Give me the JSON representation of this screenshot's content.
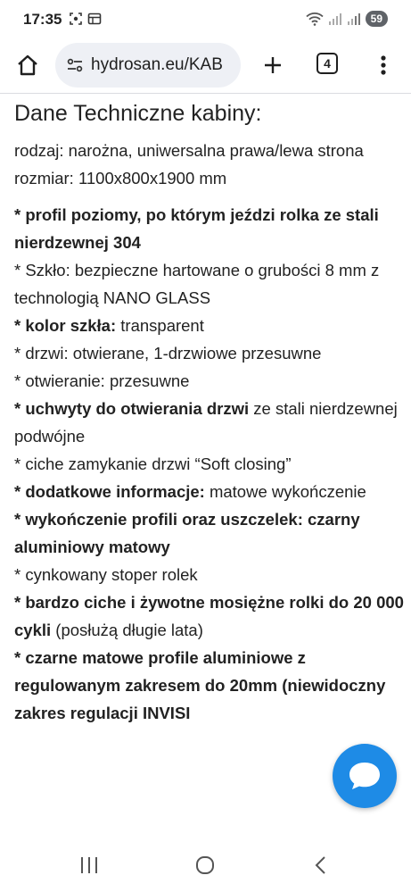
{
  "status_bar": {
    "time": "17:35",
    "battery": "59",
    "left_icons": [
      "screenshot-icon",
      "gallery-icon"
    ],
    "right_icons": [
      "wifi-icon",
      "signal-icon",
      "signal-icon"
    ]
  },
  "browser": {
    "url": "hydrosan.eu/KAB",
    "tab_count": "4",
    "icons": [
      "home-icon",
      "site-settings-icon",
      "plus-icon",
      "tabs-icon",
      "more-vert-icon"
    ]
  },
  "content": {
    "heading": "Dane Techniczne kabiny:",
    "type_line": "rodzaj: narożna, uniwersalna prawa/lewa strona",
    "size_line": "rozmiar: 1100x800x1900 mm",
    "items": [
      {
        "bold": "* profil poziomy, po którym jeździ rolka ze stali nierdzewnej 304",
        "rest": ""
      },
      {
        "bold": "",
        "rest": "* Szkło: bezpieczne hartowane o grubości 8 mm z technologią NANO GLASS"
      },
      {
        "bold": "* kolor szkła:",
        "rest": " transparent"
      },
      {
        "bold": "",
        "rest": "* drzwi: otwierane, 1-drzwiowe przesuwne"
      },
      {
        "bold": "",
        "rest": "* otwieranie: przesuwne"
      },
      {
        "bold": "* uchwyty do otwierania drzwi",
        "rest": " ze stali nierdzewnej podwójne"
      },
      {
        "bold": "",
        "rest": "* ciche zamykanie drzwi “Soft closing”"
      },
      {
        "bold": "* dodatkowe informacje:",
        "rest": " matowe wykończenie"
      },
      {
        "bold": "* wykończenie profili oraz uszczelek: czarny aluminiowy matowy",
        "rest": ""
      },
      {
        "bold": "",
        "rest": "* cynkowany stoper rolek"
      },
      {
        "bold": "* bardzo ciche i żywotne mosiężne rolki do 20 000 cykli",
        "rest": " (posłużą długie lata)"
      },
      {
        "bold": "* czarne matowe profile aluminiowe z regulowanym zakresem do 20mm (niewidoczny zakres regulacji INVISI",
        "rest": ""
      }
    ]
  },
  "chat_fab": {
    "icon": "chat-bubble-icon"
  },
  "nav_bar": {
    "icons": [
      "recents-icon",
      "home-circle-icon",
      "back-icon"
    ]
  },
  "colors": {
    "accent": "#1e8be6",
    "omnibox_bg": "#eef0f5",
    "text": "#222222"
  }
}
